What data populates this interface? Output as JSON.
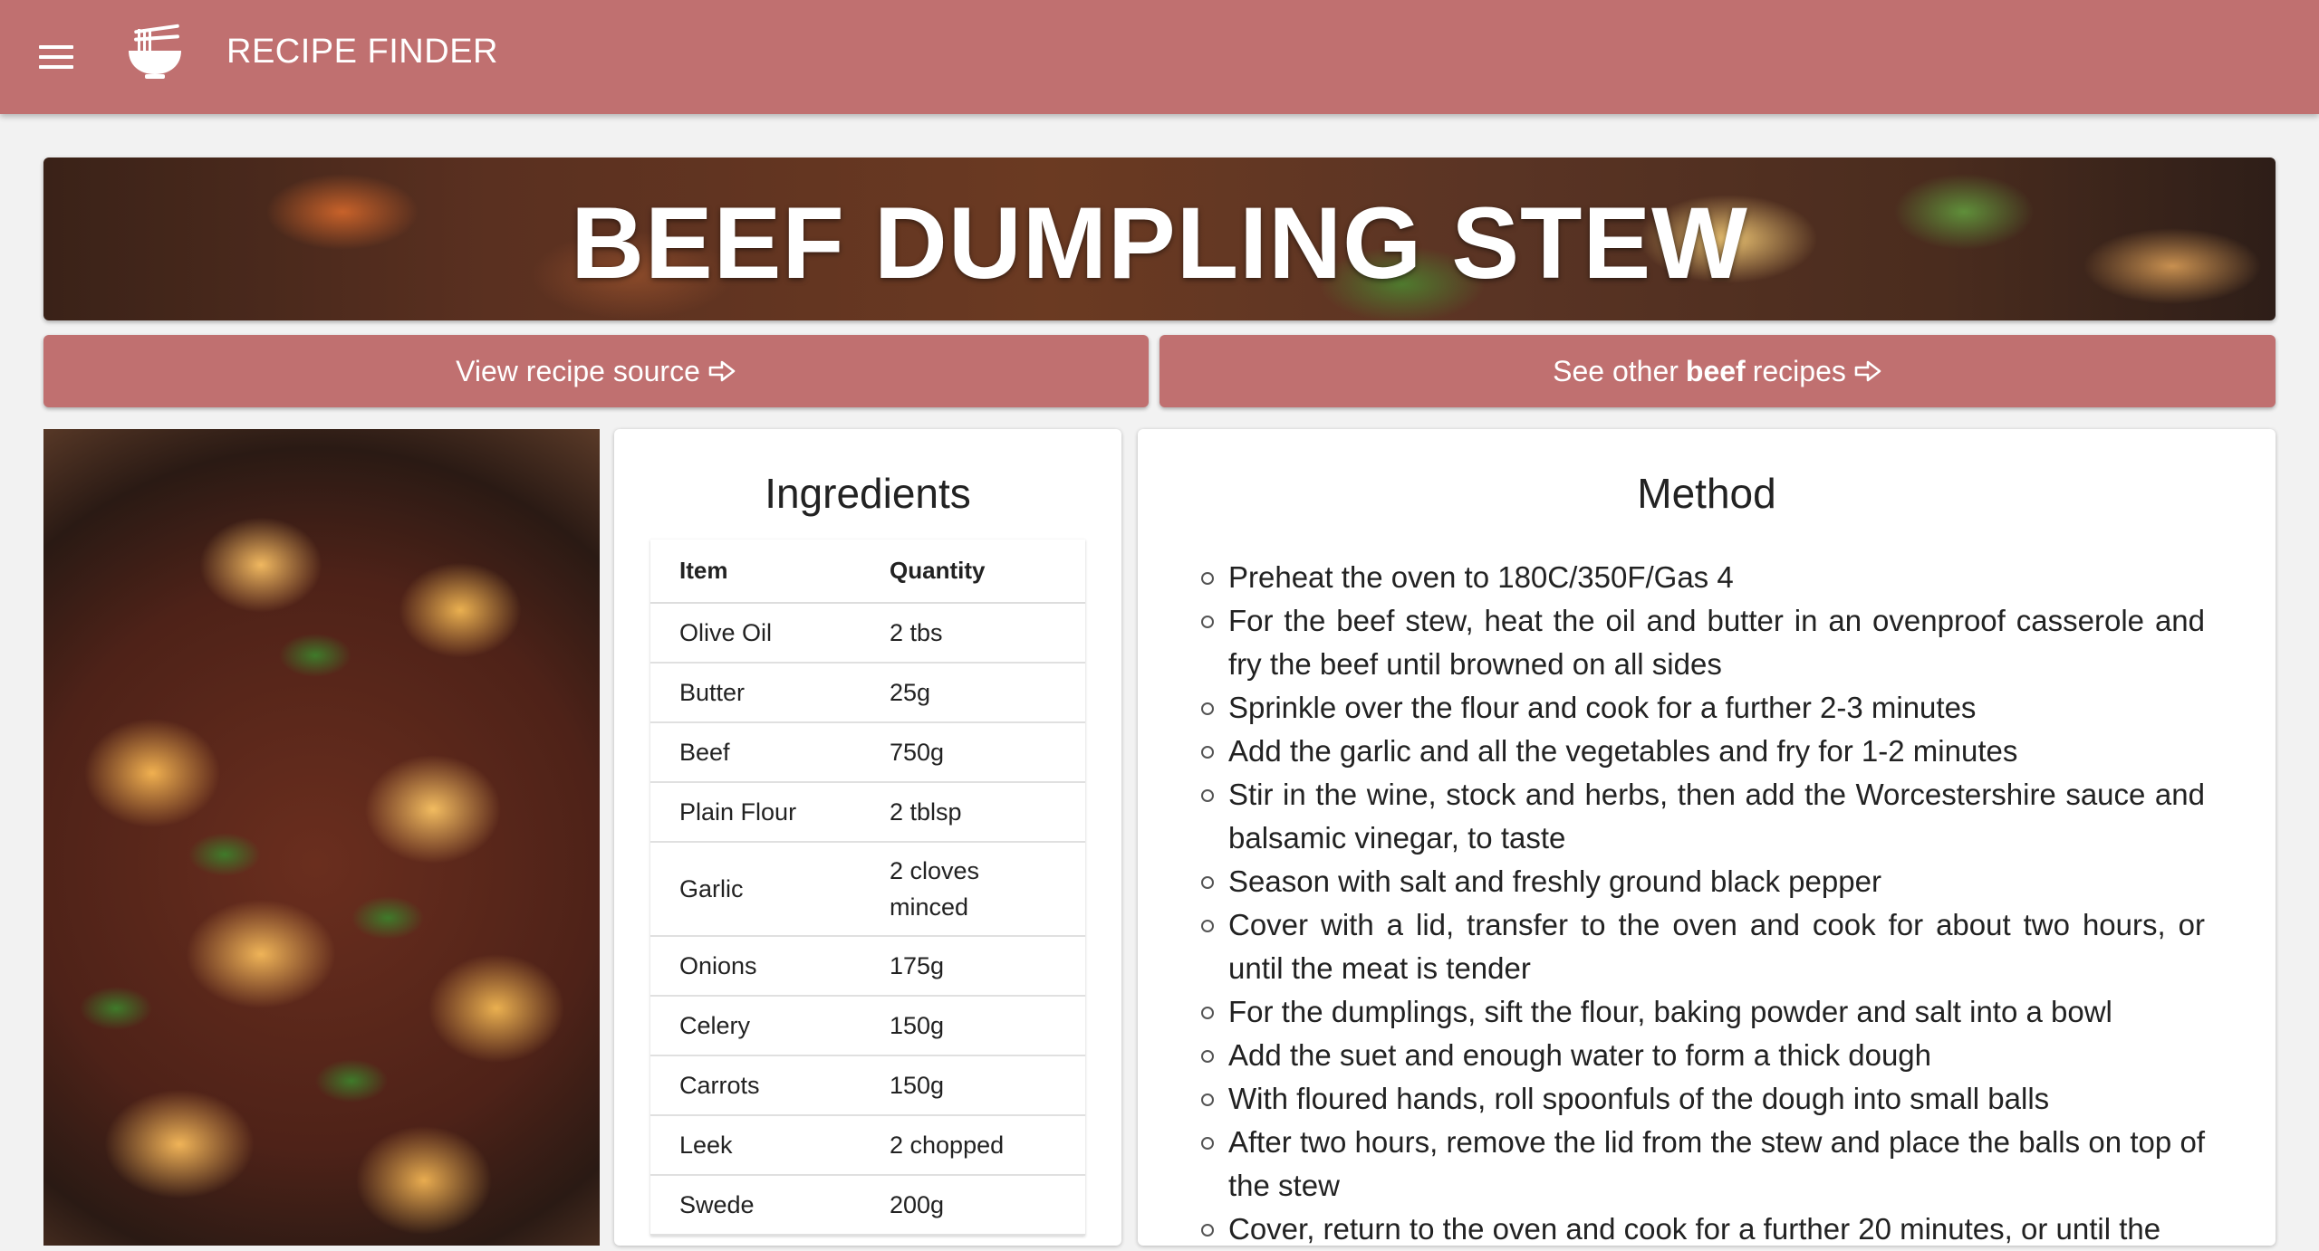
{
  "app": {
    "title": "RECIPE FINDER",
    "menu_icon": "hamburger-menu-icon",
    "logo_icon": "noodle-bowl-icon",
    "brand_color": "#c07070"
  },
  "recipe": {
    "title": "BEEF DUMPLING STEW",
    "source_button": "View recipe source",
    "other_prefix": "See other",
    "other_category": "beef",
    "other_suffix": "recipes",
    "button_icon": "external-arrow-icon"
  },
  "ingredients": {
    "heading": "Ingredients",
    "columns": [
      "Item",
      "Quantity"
    ],
    "rows": [
      {
        "item": "Olive Oil",
        "qty": "2 tbs"
      },
      {
        "item": "Butter",
        "qty": "25g"
      },
      {
        "item": "Beef",
        "qty": "750g"
      },
      {
        "item": "Plain Flour",
        "qty": "2 tblsp"
      },
      {
        "item": "Garlic",
        "qty": "2 cloves minced"
      },
      {
        "item": "Onions",
        "qty": "175g"
      },
      {
        "item": "Celery",
        "qty": "150g"
      },
      {
        "item": "Carrots",
        "qty": "150g"
      },
      {
        "item": "Leek",
        "qty": "2 chopped"
      },
      {
        "item": "Swede",
        "qty": "200g"
      }
    ]
  },
  "method": {
    "heading": "Method",
    "steps": [
      "Preheat the oven to 180C/350F/Gas 4",
      "For the beef stew, heat the oil and butter in an ovenproof casserole and fry the beef until browned on all sides",
      "Sprinkle over the flour and cook for a further 2-3 minutes",
      "Add the garlic and all the vegetables and fry for 1-2 minutes",
      "Stir in the wine, stock and herbs, then add the Worcestershire sauce and balsamic vinegar, to taste",
      "Season with salt and freshly ground black pepper",
      "Cover with a lid, transfer to the oven and cook for about two hours, or until the meat is tender",
      "For the dumplings, sift the flour, baking powder and salt into a bowl",
      "Add the suet and enough water to form a thick dough",
      "With floured hands, roll spoonfuls of the dough into small balls",
      "After two hours, remove the lid from the stew and place the balls on top of the stew",
      "Cover, return to the oven and cook for a further 20 minutes, or until the"
    ]
  }
}
